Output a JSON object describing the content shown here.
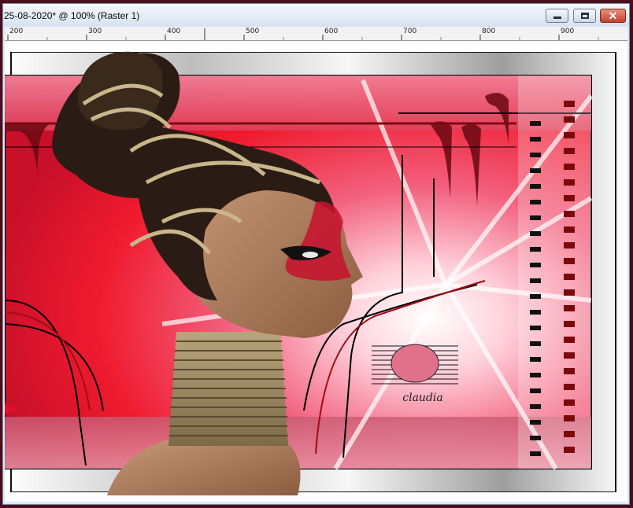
{
  "window": {
    "title": "25-08-2020* @ 100% (Raster 1)",
    "buttons": {
      "minimize": "minimize-icon",
      "maximize": "maximize-icon",
      "close": "close-icon"
    }
  },
  "ruler": {
    "labels": [
      "200",
      "300",
      "400",
      "500",
      "600",
      "700",
      "800",
      "900"
    ]
  },
  "canvas": {
    "watermark": "claudia"
  },
  "colors": {
    "accent_red": "#f01a2e",
    "dark_red": "#7a0a0a",
    "pink": "#f06d8a",
    "frame": "#4a0f1c"
  }
}
